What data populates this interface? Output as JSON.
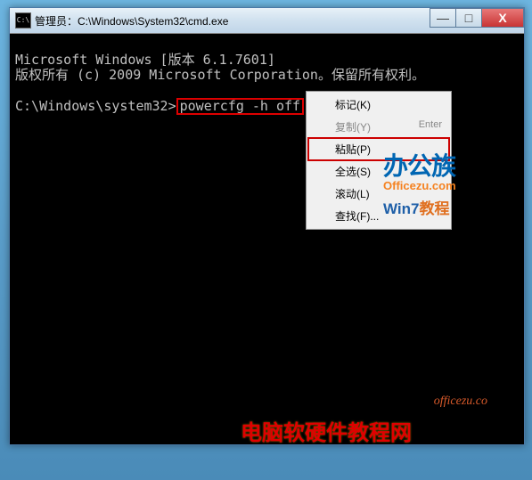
{
  "titlebar": {
    "icon_label": "C:\\",
    "title": "管理员：C:\\Windows\\System32\\cmd.exe"
  },
  "winbtns": {
    "min": "—",
    "max": "□",
    "close": "X"
  },
  "terminal": {
    "line1": "Microsoft Windows [版本 6.1.7601]",
    "line2": "版权所有 (c) 2009 Microsoft Corporation。保留所有权利。",
    "prompt": "C:\\Windows\\system32>",
    "command": "powercfg -h off"
  },
  "context_menu": {
    "items": [
      {
        "label": "标记(K)",
        "shortcut": "",
        "disabled": false,
        "highlighted": false
      },
      {
        "label": "复制(Y)",
        "shortcut": "Enter",
        "disabled": true,
        "highlighted": false
      },
      {
        "label": "粘贴(P)",
        "shortcut": "",
        "disabled": false,
        "highlighted": true
      },
      {
        "label": "全选(S)",
        "shortcut": "",
        "disabled": false,
        "highlighted": false
      },
      {
        "label": "滚动(L)",
        "shortcut": "",
        "disabled": false,
        "highlighted": false
      },
      {
        "label": "查找(F)...",
        "shortcut": "",
        "disabled": false,
        "highlighted": false
      }
    ]
  },
  "watermarks": {
    "logo_big": "办公族",
    "logo_small": "Officezu.com",
    "win7": "Win7",
    "win7_suffix": "教程",
    "corner": "officezu.co",
    "bottom": "电脑软硬件教程网"
  }
}
